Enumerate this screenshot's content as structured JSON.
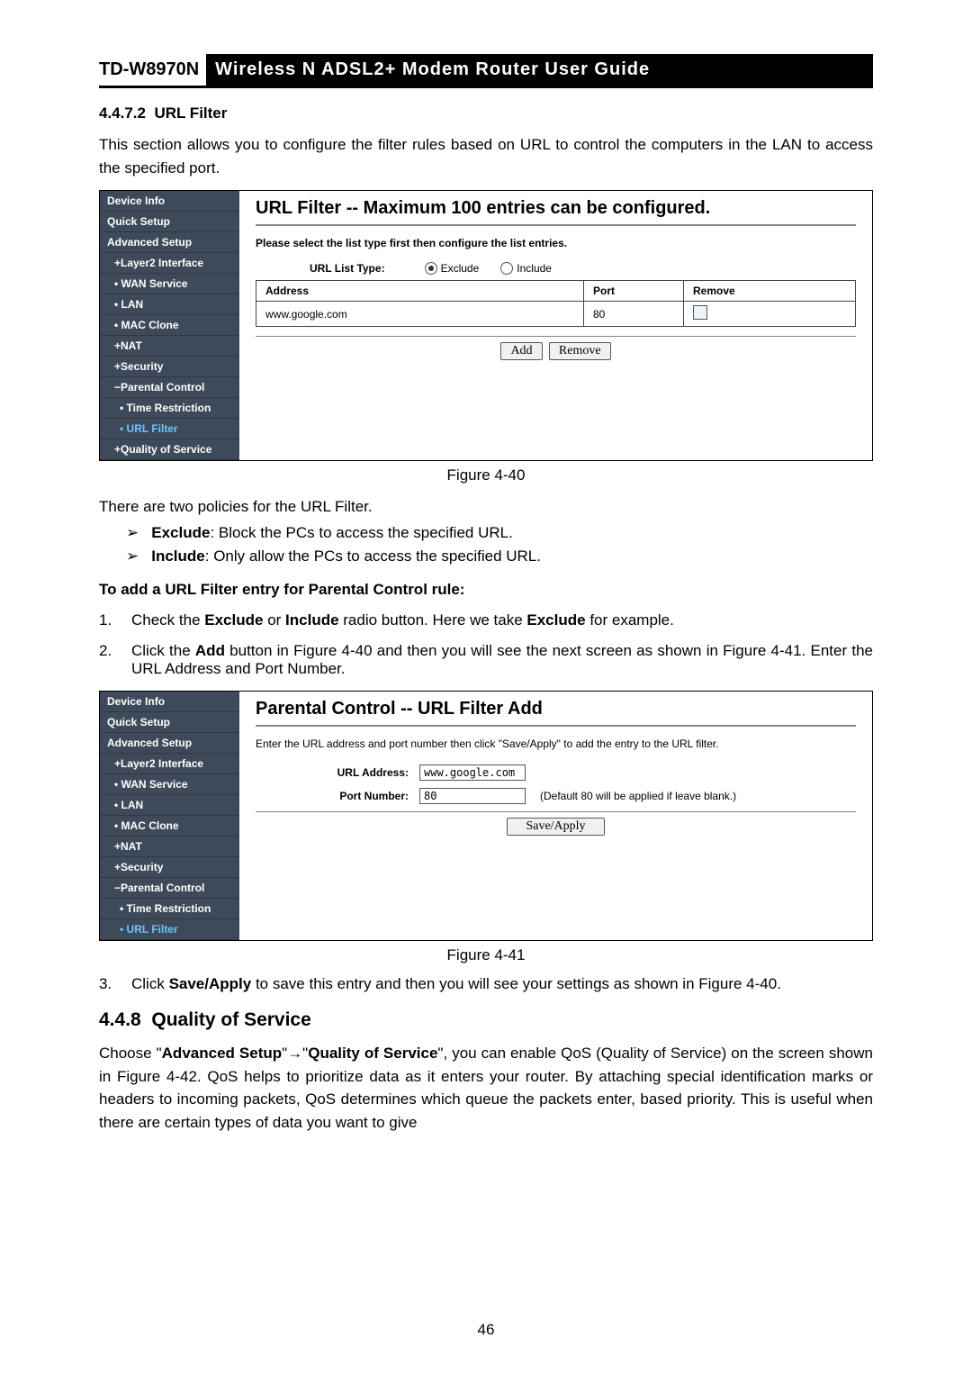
{
  "header": {
    "model": "TD-W8970N",
    "title": "Wireless N ADSL2+ Modem Router User Guide"
  },
  "section_urlFilter": {
    "number": "4.4.7.2",
    "title": "URL Filter",
    "intro": "This section allows you to configure the filter rules based on URL to control the computers in the LAN to access the specified port."
  },
  "fig40": {
    "caption": "Figure 4-40",
    "panelTitle": "URL Filter -- Maximum 100 entries can be configured.",
    "note": "Please select the list type first then configure the list entries.",
    "listTypeLabel": "URL List Type:",
    "radios": {
      "exclude": "Exclude",
      "include": "Include",
      "selected": "exclude"
    },
    "table": {
      "headers": {
        "address": "Address",
        "port": "Port",
        "remove": "Remove"
      },
      "rows": [
        {
          "address": "www.google.com",
          "port": "80"
        }
      ]
    },
    "buttons": {
      "add": "Add",
      "remove": "Remove"
    }
  },
  "nav1": {
    "items": [
      {
        "label": "Device Info"
      },
      {
        "label": "Quick Setup"
      },
      {
        "label": "Advanced Setup"
      },
      {
        "label": "+Layer2 Interface",
        "cls": "sub"
      },
      {
        "label": "• WAN Service",
        "cls": "sub"
      },
      {
        "label": "• LAN",
        "cls": "sub"
      },
      {
        "label": "• MAC Clone",
        "cls": "sub"
      },
      {
        "label": "+NAT",
        "cls": "sub"
      },
      {
        "label": "+Security",
        "cls": "sub"
      },
      {
        "label": "−Parental Control",
        "cls": "sub"
      },
      {
        "label": "• Time Restriction",
        "cls": "sub2"
      },
      {
        "label": "• URL Filter",
        "cls": "sub2 active"
      },
      {
        "label": "+Quality of Service",
        "cls": "sub"
      }
    ]
  },
  "policies": {
    "intro": "There are two policies for the URL Filter.",
    "exclude": {
      "name": "Exclude",
      "desc": ": Block the PCs to access the specified URL."
    },
    "include": {
      "name": "Include",
      "desc": ": Only allow the PCs to access the specified URL."
    }
  },
  "addRule": {
    "heading": "To add a URL Filter entry for Parental Control rule:",
    "step1_a": "Check the ",
    "step1_b": "Exclude",
    "step1_c": " or ",
    "step1_d": "Include",
    "step1_e": " radio button. Here we take ",
    "step1_f": "Exclude",
    "step1_g": " for example.",
    "step2_a": "Click the ",
    "step2_b": "Add",
    "step2_c": " button in Figure 4-40 and then you will see the next screen as shown in Figure 4-41. Enter the URL Address and Port Number."
  },
  "fig41": {
    "caption": "Figure 4-41",
    "panelTitle": "Parental Control -- URL Filter Add",
    "note": "Enter the URL address and port number then click \"Save/Apply\" to add the entry to the URL filter.",
    "urlLabel": "URL Address:",
    "urlValue": "www.google.com",
    "portLabel": "Port Number:",
    "portValue": "80",
    "portHint": "(Default 80 will be applied if leave blank.)",
    "saveBtn": "Save/Apply"
  },
  "nav2": {
    "items": [
      {
        "label": "Device Info"
      },
      {
        "label": "Quick Setup"
      },
      {
        "label": "Advanced Setup"
      },
      {
        "label": "+Layer2 Interface",
        "cls": "sub"
      },
      {
        "label": "• WAN Service",
        "cls": "sub"
      },
      {
        "label": "• LAN",
        "cls": "sub"
      },
      {
        "label": "• MAC Clone",
        "cls": "sub"
      },
      {
        "label": "+NAT",
        "cls": "sub"
      },
      {
        "label": "+Security",
        "cls": "sub"
      },
      {
        "label": "−Parental Control",
        "cls": "sub"
      },
      {
        "label": "• Time Restriction",
        "cls": "sub2"
      },
      {
        "label": "• URL Filter",
        "cls": "sub2 active"
      }
    ]
  },
  "step3_a": "Click ",
  "step3_b": "Save/Apply",
  "step3_c": " to save this entry and then you will see your settings as shown in Figure 4-40.",
  "section_qos": {
    "number": "4.4.8",
    "title": "Quality of Service",
    "para_a": "Choose \"",
    "para_b": "Advanced Setup",
    "para_c": "\"→\"",
    "para_d": "Quality of Service",
    "para_e": "\", you can enable QoS (Quality of Service) on the screen shown in Figure 4-42. QoS helps to prioritize data as it enters your router. By attaching special identification marks or headers to incoming packets, QoS determines which queue the packets enter, based priority. This is useful when there are certain types of data you want to give"
  },
  "pageNumber": "46"
}
